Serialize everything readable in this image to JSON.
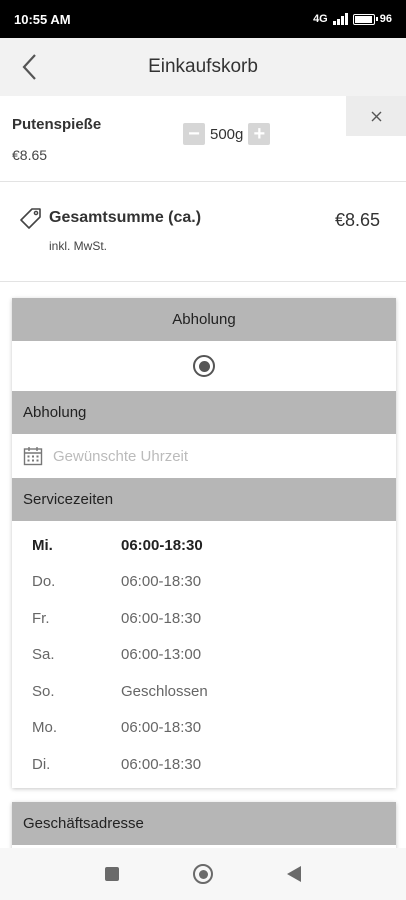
{
  "status_bar": {
    "time": "10:55 AM",
    "network_label": "4G",
    "battery_text": "96",
    "battery_level": 0.96
  },
  "header": {
    "title": "Einkaufskorb"
  },
  "cart_item": {
    "name": "Putenspieße",
    "price": "€8.65",
    "quantity": "500g",
    "minus_symbol": "−",
    "plus_symbol": "+"
  },
  "total": {
    "label": "Gesamtsumme (ca.)",
    "note": "inkl. MwSt.",
    "amount": "€8.65"
  },
  "delivery": {
    "option_label": "Abholung",
    "option_selected": true,
    "section_title": "Abholung",
    "time_placeholder": "Gewünschte Uhrzeit"
  },
  "service_hours": {
    "title": "Servicezeiten",
    "rows": [
      {
        "day": "Mi.",
        "hours": "06:00-18:30"
      },
      {
        "day": "Do.",
        "hours": "06:00-18:30"
      },
      {
        "day": "Fr.",
        "hours": "06:00-18:30"
      },
      {
        "day": "Sa.",
        "hours": "06:00-13:00"
      },
      {
        "day": "So.",
        "hours": "Geschlossen"
      },
      {
        "day": "Mo.",
        "hours": "06:00-18:30"
      },
      {
        "day": "Di.",
        "hours": "06:00-18:30"
      }
    ]
  },
  "address": {
    "title": "Geschäftsadresse"
  },
  "icons": {
    "back": "chevron-left-icon",
    "close": "close-icon",
    "tag": "tag-icon",
    "calendar": "calendar-icon"
  },
  "colors": {
    "section_bar": "#b6b6b6",
    "app_bar": "#f2f2f2"
  }
}
